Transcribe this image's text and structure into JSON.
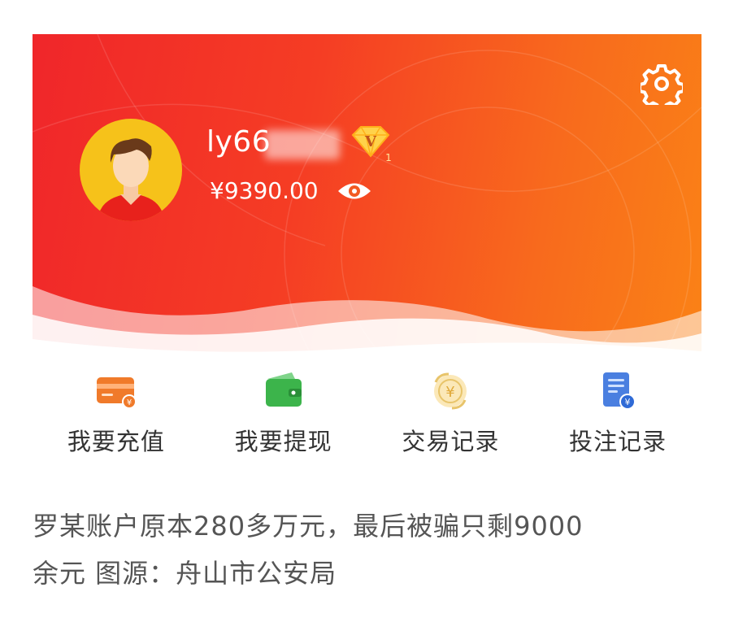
{
  "header": {
    "username": "ly66",
    "vip_level": "V",
    "vip_sub": "1",
    "balance": "¥9390.00"
  },
  "icons": {
    "settings": "gear-icon",
    "visibility": "eye-icon",
    "vip": "diamond-vip-icon"
  },
  "menu": {
    "items": [
      {
        "label": "我要充值",
        "icon": "card-recharge-icon",
        "color": "#f07a2a"
      },
      {
        "label": "我要提现",
        "icon": "wallet-icon",
        "color": "#3cb44b"
      },
      {
        "label": "交易记录",
        "icon": "yuan-exchange-icon",
        "color": "#e8c46a"
      },
      {
        "label": "投注记录",
        "icon": "bet-document-icon",
        "color": "#4a7fe0"
      }
    ]
  },
  "caption": {
    "line1": "罗某账户原本280多万元，最后被骗只剩9000",
    "line2": "余元 图源：舟山市公安局"
  },
  "colors": {
    "hero_start": "#f0262a",
    "hero_end": "#fa8216",
    "avatar_bg": "#f6c21a"
  }
}
